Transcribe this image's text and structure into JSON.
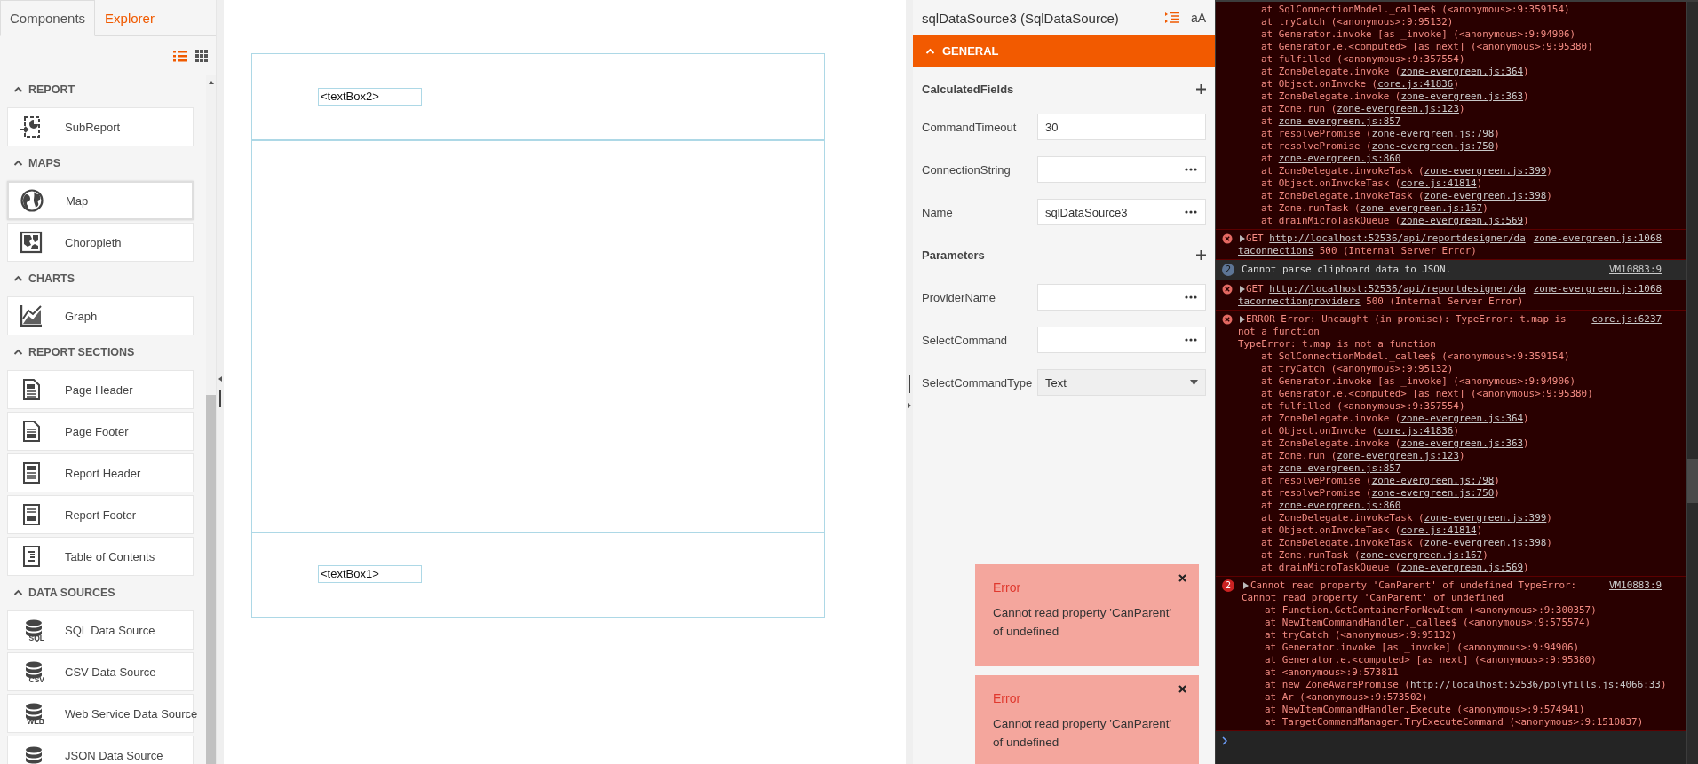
{
  "components_panel": {
    "tabs": [
      {
        "label": "Components",
        "selected": true
      },
      {
        "label": "Explorer",
        "selected": false
      }
    ],
    "view_toggles": [
      {
        "kind": "list",
        "selected": true
      },
      {
        "kind": "grid",
        "selected": false
      }
    ],
    "sections": [
      {
        "title": "REPORT",
        "expanded": true,
        "items": [
          {
            "label": "SubReport",
            "kind": "subreport",
            "selected": false
          }
        ]
      },
      {
        "title": "MAPS",
        "expanded": true,
        "items": [
          {
            "label": "Map",
            "kind": "map",
            "selected": true
          },
          {
            "label": "Choropleth",
            "kind": "choropleth",
            "selected": false
          }
        ]
      },
      {
        "title": "CHARTS",
        "expanded": true,
        "items": [
          {
            "label": "Graph",
            "kind": "graph",
            "selected": false
          }
        ]
      },
      {
        "title": "REPORT SECTIONS",
        "expanded": true,
        "items": [
          {
            "label": "Page Header",
            "kind": "page-header",
            "selected": false
          },
          {
            "label": "Page Footer",
            "kind": "page-footer",
            "selected": false
          },
          {
            "label": "Report Header",
            "kind": "report-header",
            "selected": false
          },
          {
            "label": "Report Footer",
            "kind": "report-footer",
            "selected": false
          },
          {
            "label": "Table of Contents",
            "kind": "toc",
            "selected": false
          }
        ]
      },
      {
        "title": "DATA SOURCES",
        "expanded": true,
        "items": [
          {
            "label": "SQL Data Source",
            "kind": "database",
            "icon_text": "SQL",
            "selected": false
          },
          {
            "label": "CSV Data Source",
            "kind": "database",
            "icon_text": "CSV",
            "selected": false
          },
          {
            "label": "Web Service Data Source",
            "kind": "database",
            "icon_text": "WEB",
            "selected": false
          },
          {
            "label": "JSON Data Source",
            "kind": "database",
            "selected": false
          }
        ]
      }
    ]
  },
  "report_canvas": {
    "bands": [
      {
        "kind": "header",
        "textbox": "<textBox2>"
      },
      {
        "kind": "detail"
      },
      {
        "kind": "footer",
        "textbox": "<textBox1>"
      }
    ]
  },
  "properties": {
    "title": "sqlDataSource3 (SqlDataSource)",
    "toolbar": [
      {
        "kind": "categorized",
        "selected": true
      },
      {
        "kind": "alphabetical",
        "label": "aA",
        "selected": false
      }
    ],
    "category": {
      "label": "GENERAL",
      "expanded": true
    },
    "rows": [
      {
        "kind": "group",
        "label": "CalculatedFields"
      },
      {
        "kind": "text",
        "label": "CommandTimeout",
        "value": "30"
      },
      {
        "kind": "editor",
        "label": "ConnectionString"
      },
      {
        "kind": "editor",
        "label": "Name",
        "value": "sqlDataSource3"
      },
      {
        "kind": "group",
        "label": "Parameters"
      },
      {
        "kind": "editor",
        "label": "ProviderName"
      },
      {
        "kind": "editor",
        "label": "SelectCommand"
      },
      {
        "kind": "dropdown",
        "label": "SelectCommandType",
        "value": "Text"
      }
    ]
  },
  "toasts": [
    {
      "title": "Error",
      "message": "Cannot read property 'CanParent' of undefined"
    },
    {
      "title": "Error",
      "message": "Cannot read property 'CanParent' of undefined"
    }
  ],
  "console": {
    "messages": [
      {
        "kind": "stack",
        "expandable": false,
        "frames": [
          {
            "text": "at SqlConnectionModel._callee$ (<anonymous>:9:359154)"
          },
          {
            "text": "at tryCatch (<anonymous>:9:95132)"
          },
          {
            "text": "at Generator.invoke [as _invoke] (<anonymous>:9:94906)"
          },
          {
            "text": "at Generator.e.<computed> [as next] (<anonymous>:9:95380)"
          },
          {
            "text": "at fulfilled (<anonymous>:9:357554)"
          },
          {
            "text": "at ZoneDelegate.invoke (",
            "link": "zone-evergreen.js:364",
            "after": ")"
          },
          {
            "text": "at Object.onInvoke (",
            "link": "core.js:41836",
            "after": ")"
          },
          {
            "text": "at ZoneDelegate.invoke (",
            "link": "zone-evergreen.js:363",
            "after": ")"
          },
          {
            "text": "at Zone.run (",
            "link": "zone-evergreen.js:123",
            "after": ")"
          },
          {
            "text": "at ",
            "link": "zone-evergreen.js:857"
          },
          {
            "text": "at resolvePromise (",
            "link": "zone-evergreen.js:798",
            "after": ")"
          },
          {
            "text": "at resolvePromise (",
            "link": "zone-evergreen.js:750",
            "after": ")"
          },
          {
            "text": "at ",
            "link": "zone-evergreen.js:860"
          },
          {
            "text": "at ZoneDelegate.invokeTask (",
            "link": "zone-evergreen.js:399",
            "after": ")"
          },
          {
            "text": "at Object.onInvokeTask (",
            "link": "core.js:41814",
            "after": ")"
          },
          {
            "text": "at ZoneDelegate.invokeTask (",
            "link": "zone-evergreen.js:398",
            "after": ")"
          },
          {
            "text": "at Zone.runTask (",
            "link": "zone-evergreen.js:167",
            "after": ")"
          },
          {
            "text": "at drainMicroTaskQueue (",
            "link": "zone-evergreen.js:569",
            "after": ")"
          }
        ]
      },
      {
        "kind": "error",
        "expandable": true,
        "lines": [
          {
            "text": "GET ",
            "link": "http://localhost:52536/api/reportdesigner/da"
          },
          {
            "link": "taconnections",
            "after": " 500 (Internal Server Error)"
          }
        ],
        "source": "zone-evergreen.js:1068"
      },
      {
        "kind": "info",
        "count": "2",
        "expandable": false,
        "lines": [
          {
            "text": "Cannot parse clipboard data to JSON."
          }
        ],
        "source": "VM10883:9"
      },
      {
        "kind": "error",
        "expandable": true,
        "lines": [
          {
            "text": "GET ",
            "link": "http://localhost:52536/api/reportdesigner/da"
          },
          {
            "link": "taconnectionproviders",
            "after": " 500 (Internal Server Error)"
          }
        ],
        "source": "zone-evergreen.js:1068"
      },
      {
        "kind": "error",
        "expandable": true,
        "lines": [
          {
            "text": "ERROR Error: Uncaught (in promise): TypeError: t.map is"
          },
          {
            "text": "not a function"
          }
        ],
        "source": "core.js:6237",
        "detail": "TypeError: t.map is not a function",
        "frames": [
          {
            "text": "at SqlConnectionModel._callee$ (<anonymous>:9:359154)"
          },
          {
            "text": "at tryCatch (<anonymous>:9:95132)"
          },
          {
            "text": "at Generator.invoke [as _invoke] (<anonymous>:9:94906)"
          },
          {
            "text": "at Generator.e.<computed> [as next] (<anonymous>:9:95380)"
          },
          {
            "text": "at fulfilled (<anonymous>:9:357554)"
          },
          {
            "text": "at ZoneDelegate.invoke (",
            "link": "zone-evergreen.js:364",
            "after": ")"
          },
          {
            "text": "at Object.onInvoke (",
            "link": "core.js:41836",
            "after": ")"
          },
          {
            "text": "at ZoneDelegate.invoke (",
            "link": "zone-evergreen.js:363",
            "after": ")"
          },
          {
            "text": "at Zone.run (",
            "link": "zone-evergreen.js:123",
            "after": ")"
          },
          {
            "text": "at ",
            "link": "zone-evergreen.js:857"
          },
          {
            "text": "at resolvePromise (",
            "link": "zone-evergreen.js:798",
            "after": ")"
          },
          {
            "text": "at resolvePromise (",
            "link": "zone-evergreen.js:750",
            "after": ")"
          },
          {
            "text": "at ",
            "link": "zone-evergreen.js:860"
          },
          {
            "text": "at ZoneDelegate.invokeTask (",
            "link": "zone-evergreen.js:399",
            "after": ")"
          },
          {
            "text": "at Object.onInvokeTask (",
            "link": "core.js:41814",
            "after": ")"
          },
          {
            "text": "at ZoneDelegate.invokeTask (",
            "link": "zone-evergreen.js:398",
            "after": ")"
          },
          {
            "text": "at Zone.runTask (",
            "link": "zone-evergreen.js:167",
            "after": ")"
          },
          {
            "text": "at drainMicroTaskQueue (",
            "link": "zone-evergreen.js:569",
            "after": ")"
          }
        ]
      },
      {
        "kind": "error",
        "count": "2",
        "expandable": true,
        "lines": [
          {
            "text": "Cannot read property 'CanParent' of undefined TypeError:"
          },
          {
            "text": "Cannot read property 'CanParent' of undefined"
          }
        ],
        "source": "VM10883:9",
        "frames": [
          {
            "text": "at Function.GetContainerForNewItem (<anonymous>:9:300357)"
          },
          {
            "text": "at NewItemCommandHandler._callee$ (<anonymous>:9:575574)"
          },
          {
            "text": "at tryCatch (<anonymous>:9:95132)"
          },
          {
            "text": "at Generator.invoke [as _invoke] (<anonymous>:9:94906)"
          },
          {
            "text": "at Generator.e.<computed> [as next] (<anonymous>:9:95380)"
          },
          {
            "text": "at <anonymous>:9:573811"
          },
          {
            "text": "at new ZoneAwarePromise (",
            "link": "http://localhost:52536/polyfills.js:4066:33",
            "after": ")"
          },
          {
            "text": "at Ar (<anonymous>:9:573502)"
          },
          {
            "text": "at NewItemCommandHandler.Execute (<anonymous>:9:574941)"
          },
          {
            "text": "at TargetCommandManager.TryExecuteCommand (<anonymous>:9:1510837)"
          }
        ]
      }
    ]
  }
}
